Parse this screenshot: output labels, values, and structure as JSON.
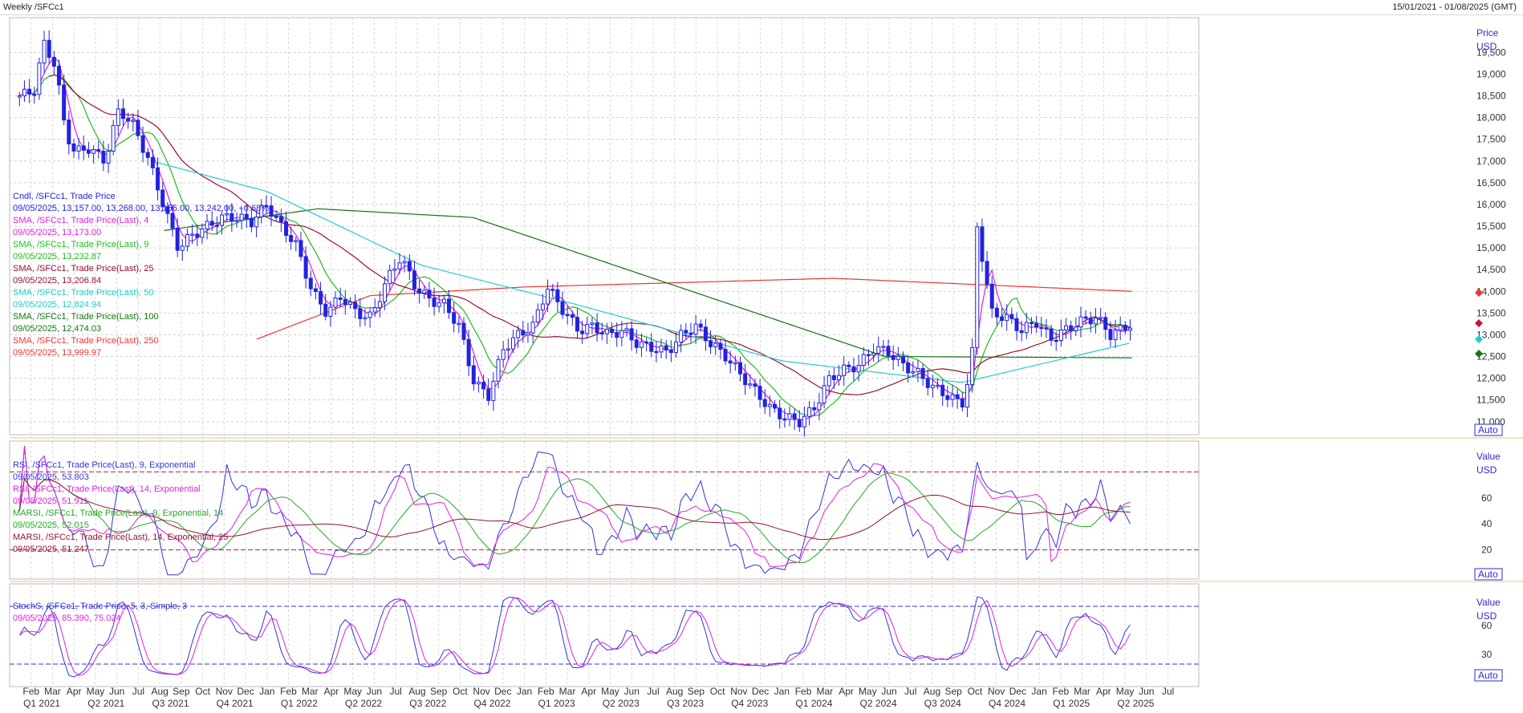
{
  "header": {
    "title": "Weekly /SFCc1",
    "range": "15/01/2021 - 01/08/2025 (GMT)"
  },
  "colors": {
    "candle": "#2222e0",
    "sma4": "#e020e0",
    "sma9": "#22bb22",
    "sma25": "#991133",
    "sma50": "#22cccc",
    "sma100": "#117711",
    "sma250": "#ee3333",
    "axis": "#2b2bd0"
  },
  "x_axis": {
    "months": [
      "Feb",
      "Mar",
      "Apr",
      "May",
      "Jun",
      "Jul",
      "Aug",
      "Sep",
      "Oct",
      "Nov",
      "Dec",
      "Jan",
      "Feb",
      "Mar",
      "Apr",
      "May",
      "Jun",
      "Jul",
      "Aug",
      "Sep",
      "Oct",
      "Nov",
      "Dec",
      "Jan",
      "Feb",
      "Mar",
      "Apr",
      "May",
      "Jun",
      "Jul",
      "Aug",
      "Sep",
      "Oct",
      "Nov",
      "Dec",
      "Jan",
      "Feb",
      "Mar",
      "Apr",
      "May",
      "Jun",
      "Jul",
      "Aug",
      "Sep",
      "Oct",
      "Nov",
      "Dec",
      "Jan",
      "Feb",
      "Mar",
      "Apr",
      "May",
      "Jun",
      "Jul"
    ],
    "quarters": [
      "Q1 2021",
      "Q2 2021",
      "Q3 2021",
      "Q4 2021",
      "Q1 2022",
      "Q2 2022",
      "Q3 2022",
      "Q4 2022",
      "Q1 2023",
      "Q2 2023",
      "Q3 2023",
      "Q4 2023",
      "Q1 2024",
      "Q2 2024",
      "Q3 2024",
      "Q4 2024",
      "Q1 2025",
      "Q2 2025"
    ]
  },
  "price_panel": {
    "axis_title": "Price",
    "axis_unit": "USD",
    "auto_label": "Auto",
    "ticks": [
      "19,500",
      "19,000",
      "18,500",
      "18,000",
      "17,500",
      "17,000",
      "16,500",
      "16,000",
      "15,500",
      "15,000",
      "14,500",
      "14,000",
      "13,500",
      "13,000",
      "12,500",
      "12,000",
      "11,500",
      "11,000"
    ],
    "legend": [
      {
        "name": "Cndl, /SFCc1, Trade Price",
        "values": "09/05/2025, 13,157.00, 13,268.00, 13,156.00, 13,242.00, +0.68%"
      },
      {
        "name": "SMA, /SFCc1, Trade Price(Last), 4",
        "values": "09/05/2025, 13,173.00"
      },
      {
        "name": "SMA, /SFCc1, Trade Price(Last), 9",
        "values": "09/05/2025, 13,232.87"
      },
      {
        "name": "SMA, /SFCc1, Trade Price(Last), 25",
        "values": "09/05/2025, 13,206.84"
      },
      {
        "name": "SMA, /SFCc1, Trade Price(Last), 50",
        "values": "09/05/2025, 12,824.94"
      },
      {
        "name": "SMA, /SFCc1, Trade Price(Last), 100",
        "values": "09/05/2025, 12,474.03"
      },
      {
        "name": "SMA, /SFCc1, Trade Price(Last), 250",
        "values": "09/05/2025, 13,999.97"
      }
    ]
  },
  "rsi_panel": {
    "axis_title": "Value",
    "axis_unit": "USD",
    "auto_label": "Auto",
    "ticks": [
      "60",
      "40",
      "20"
    ],
    "legend": [
      {
        "name": "RSI, /SFCc1, Trade Price(Last), 9, Exponential",
        "values": "09/05/2025, 53.803"
      },
      {
        "name": "RSI, /SFCc1, Trade Price(Last), 14, Exponential",
        "values": "09/05/2025, 51.911"
      },
      {
        "name": "MARSI, /SFCc1, Trade Price(Last), 9, Exponential, 14",
        "values": "09/05/2025, 52.015"
      },
      {
        "name": "MARSI, /SFCc1, Trade Price(Last), 14, Exponential, 25",
        "values": "09/05/2025, 51.247"
      }
    ]
  },
  "stoch_panel": {
    "axis_title": "Value",
    "axis_unit": "USD",
    "auto_label": "Auto",
    "ticks": [
      "60",
      "30"
    ],
    "legend": [
      {
        "name": "StochS, /SFCc1, Trade Price,  5, 3, Simple, 3",
        "values": "09/05/2025, 85.390, 75.024"
      }
    ]
  },
  "chart_data": {
    "type": "candlestick",
    "title": "Weekly /SFCc1",
    "ylabel": "Price USD",
    "ylim": [
      10700,
      20300
    ],
    "price_points": [
      [
        "2021-01-15",
        18500
      ],
      [
        "2021-02-05",
        18600
      ],
      [
        "2021-02-19",
        19700
      ],
      [
        "2021-03-05",
        19200
      ],
      [
        "2021-03-19",
        17700
      ],
      [
        "2021-04-02",
        17200
      ],
      [
        "2021-04-23",
        17300
      ],
      [
        "2021-05-14",
        17000
      ],
      [
        "2021-06-04",
        18200
      ],
      [
        "2021-06-25",
        17800
      ],
      [
        "2021-07-16",
        17000
      ],
      [
        "2021-08-06",
        16000
      ],
      [
        "2021-08-27",
        15000
      ],
      [
        "2021-09-17",
        15300
      ],
      [
        "2021-10-08",
        15500
      ],
      [
        "2021-10-29",
        15700
      ],
      [
        "2021-11-19",
        15700
      ],
      [
        "2021-12-10",
        15600
      ],
      [
        "2021-12-31",
        16000
      ],
      [
        "2022-01-21",
        15500
      ],
      [
        "2022-02-11",
        15100
      ],
      [
        "2022-03-04",
        14000
      ],
      [
        "2022-03-25",
        13500
      ],
      [
        "2022-04-15",
        13900
      ],
      [
        "2022-05-06",
        13500
      ],
      [
        "2022-05-27",
        13400
      ],
      [
        "2022-06-17",
        14200
      ],
      [
        "2022-07-08",
        14800
      ],
      [
        "2022-07-29",
        14100
      ],
      [
        "2022-08-19",
        13800
      ],
      [
        "2022-09-09",
        13700
      ],
      [
        "2022-09-30",
        13200
      ],
      [
        "2022-10-21",
        11900
      ],
      [
        "2022-11-11",
        11600
      ],
      [
        "2022-12-02",
        12700
      ],
      [
        "2022-12-23",
        13000
      ],
      [
        "2023-01-13",
        13200
      ],
      [
        "2023-02-03",
        14100
      ],
      [
        "2023-02-24",
        13600
      ],
      [
        "2023-03-17",
        13100
      ],
      [
        "2023-04-07",
        13200
      ],
      [
        "2023-04-28",
        13000
      ],
      [
        "2023-05-19",
        13100
      ],
      [
        "2023-06-09",
        12800
      ],
      [
        "2023-06-30",
        12700
      ],
      [
        "2023-07-21",
        12600
      ],
      [
        "2023-08-11",
        13000
      ],
      [
        "2023-09-01",
        13200
      ],
      [
        "2023-09-22",
        12800
      ],
      [
        "2023-10-13",
        12500
      ],
      [
        "2023-11-03",
        12100
      ],
      [
        "2023-11-24",
        11700
      ],
      [
        "2023-12-15",
        11300
      ],
      [
        "2024-01-05",
        11100
      ],
      [
        "2024-01-26",
        11000
      ],
      [
        "2024-02-16",
        11300
      ],
      [
        "2024-03-08",
        12000
      ],
      [
        "2024-03-29",
        12200
      ],
      [
        "2024-04-19",
        12300
      ],
      [
        "2024-05-10",
        12700
      ],
      [
        "2024-05-31",
        12600
      ],
      [
        "2024-06-21",
        12300
      ],
      [
        "2024-07-12",
        12100
      ],
      [
        "2024-08-02",
        11800
      ],
      [
        "2024-08-23",
        11600
      ],
      [
        "2024-09-13",
        11400
      ],
      [
        "2024-09-27",
        12300
      ],
      [
        "2024-10-04",
        15500
      ],
      [
        "2024-10-25",
        13500
      ],
      [
        "2024-11-15",
        13400
      ],
      [
        "2024-12-06",
        13100
      ],
      [
        "2024-12-27",
        13300
      ],
      [
        "2025-01-17",
        12900
      ],
      [
        "2025-02-07",
        13100
      ],
      [
        "2025-02-28",
        13300
      ],
      [
        "2025-03-21",
        13400
      ],
      [
        "2025-04-11",
        13000
      ],
      [
        "2025-05-09",
        13242
      ]
    ],
    "series": [
      {
        "name": "SMA 250",
        "values": [
          [
            2021.96,
            12900
          ],
          [
            2022.4,
            13900
          ],
          [
            2023.0,
            14100
          ],
          [
            2024.2,
            14300
          ],
          [
            2025.36,
            14000
          ]
        ]
      },
      {
        "name": "SMA 100",
        "values": [
          [
            2021.6,
            15400
          ],
          [
            2022.2,
            15900
          ],
          [
            2022.8,
            15700
          ],
          [
            2023.5,
            14300
          ],
          [
            2024.4,
            12500
          ],
          [
            2025.36,
            12470
          ]
        ]
      },
      {
        "name": "SMA 50",
        "values": [
          [
            2021.55,
            17000
          ],
          [
            2022.0,
            16300
          ],
          [
            2022.6,
            14600
          ],
          [
            2023.2,
            13700
          ],
          [
            2024.0,
            12400
          ],
          [
            2024.7,
            11900
          ],
          [
            2025.36,
            12820
          ]
        ]
      }
    ],
    "rsi_ylim": [
      0,
      100
    ],
    "rsi_ref_lines": [
      20,
      80
    ],
    "stoch_ylim": [
      0,
      100
    ],
    "stoch_ref_lines": [
      20,
      80
    ]
  }
}
